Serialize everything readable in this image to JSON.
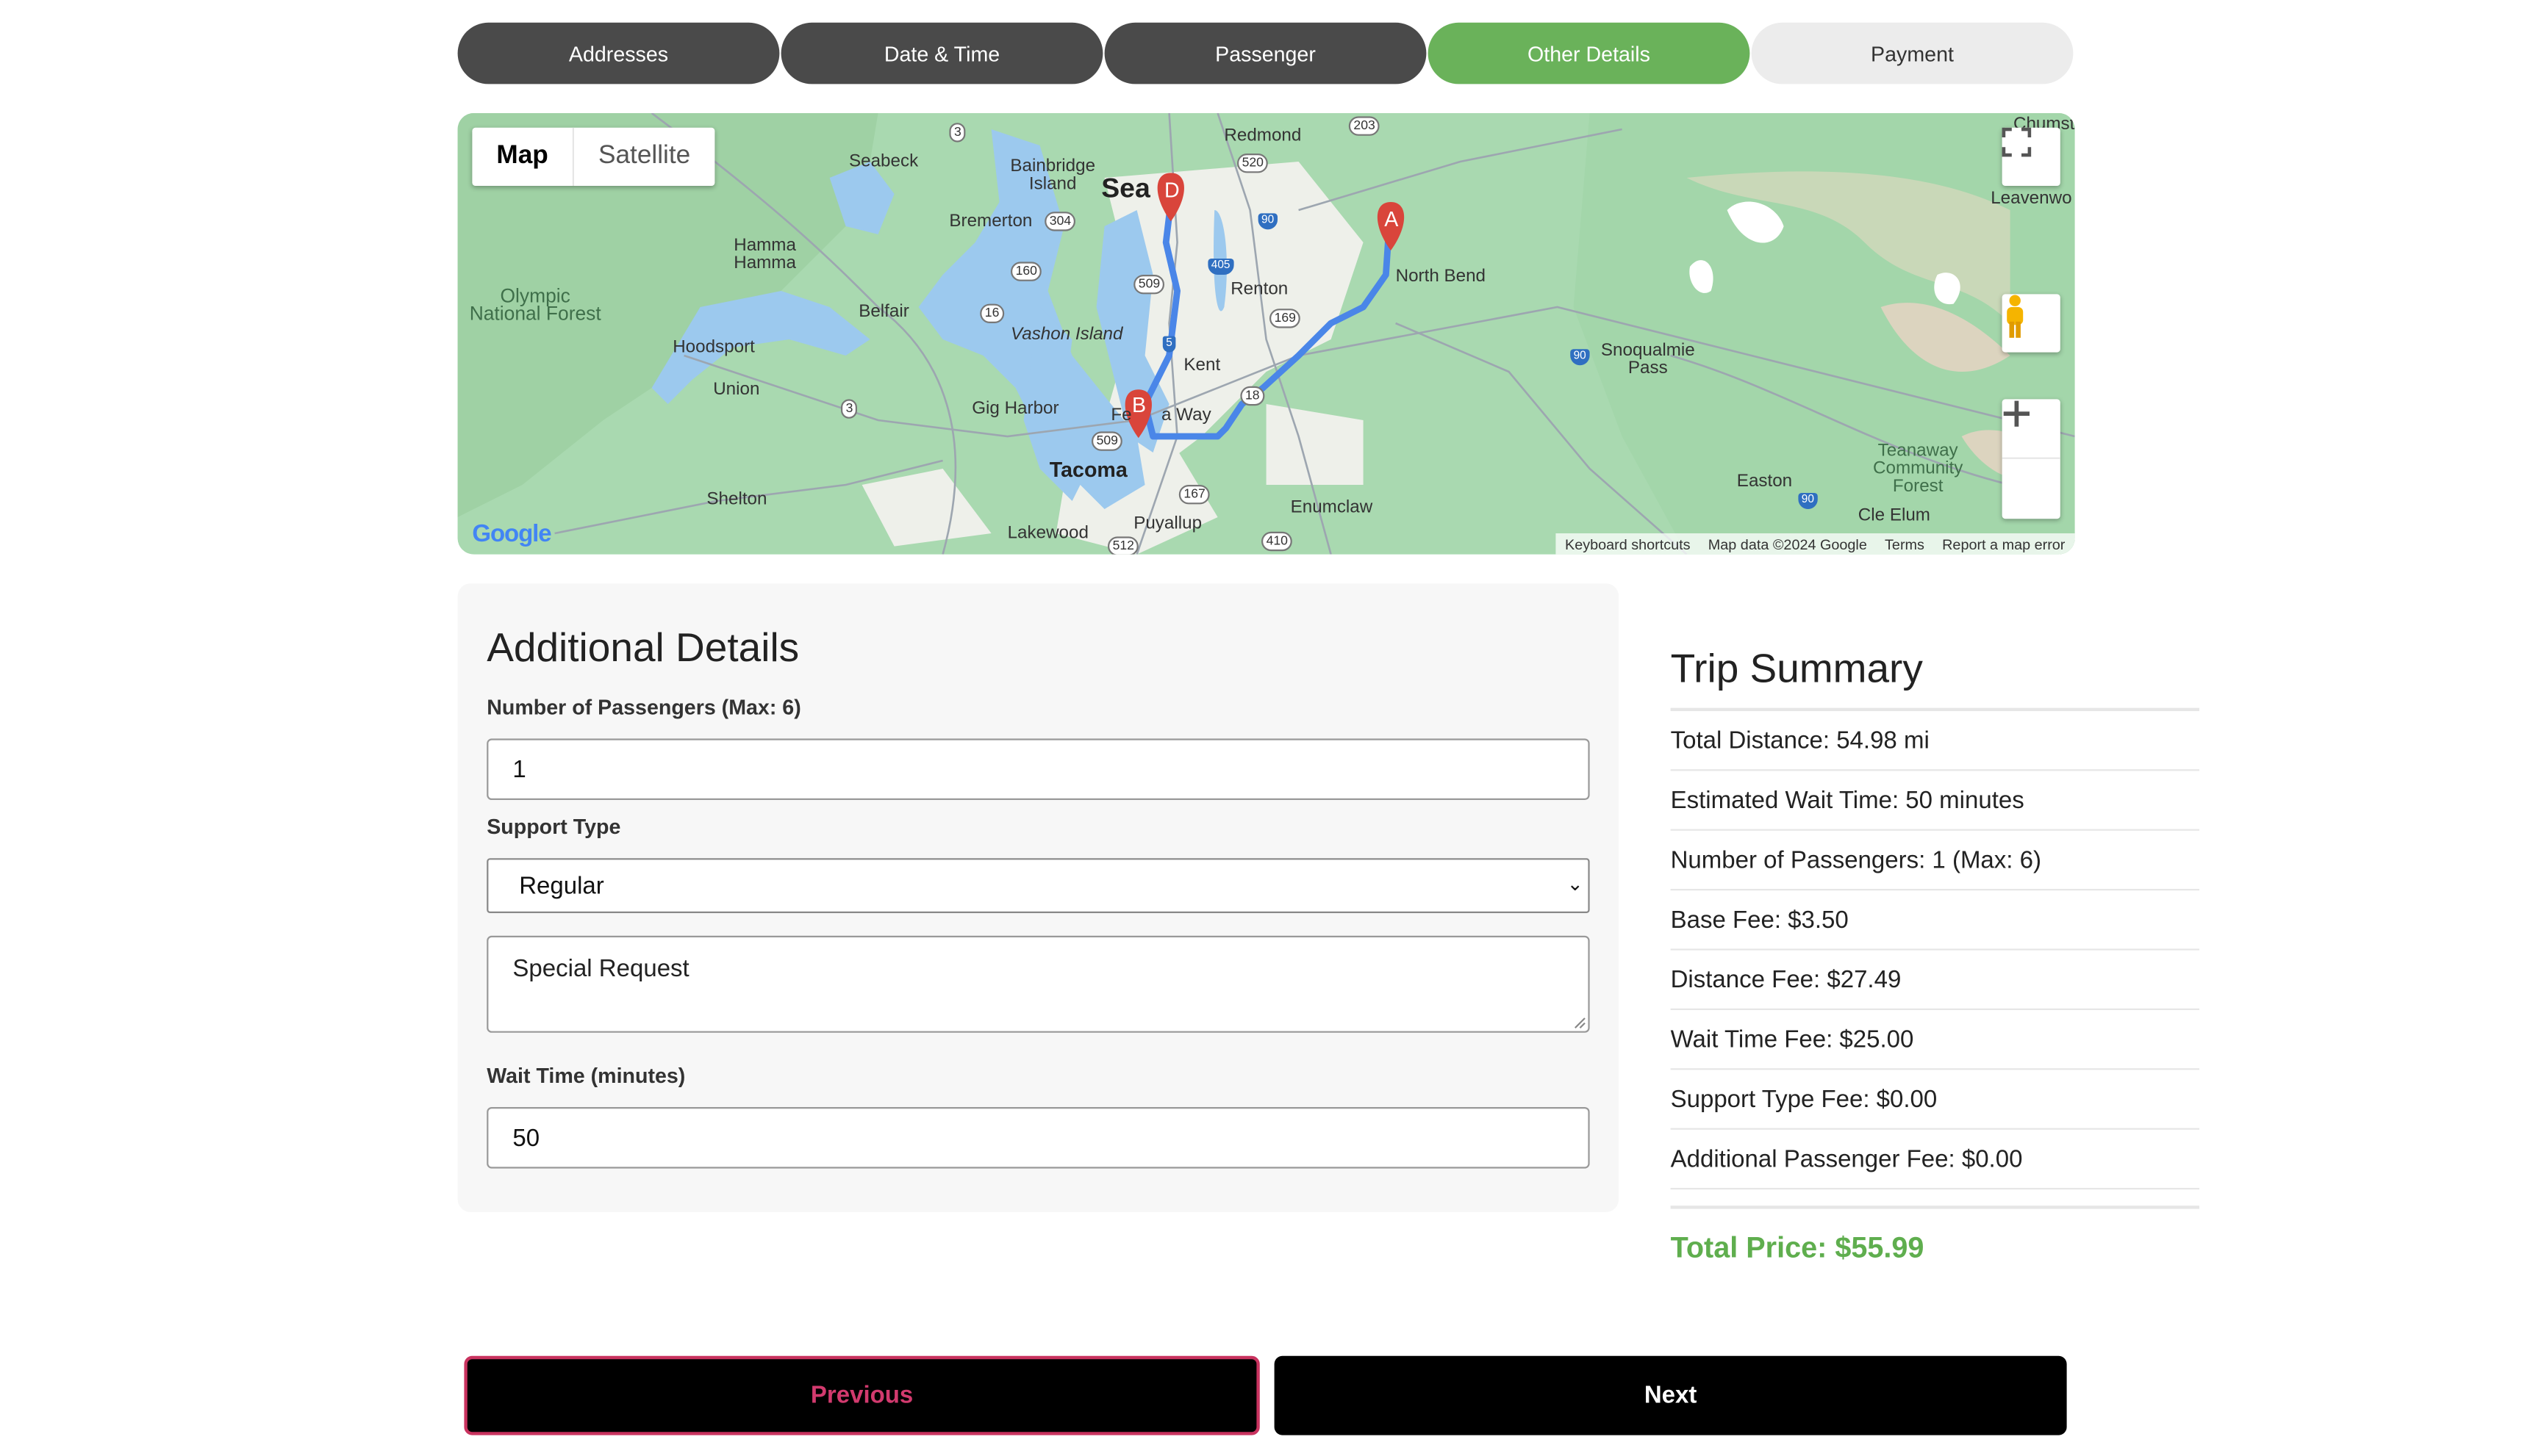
{
  "steps": [
    {
      "label": "Addresses",
      "state": "done"
    },
    {
      "label": "Date & Time",
      "state": "done"
    },
    {
      "label": "Passenger",
      "state": "done"
    },
    {
      "label": "Other Details",
      "state": "active"
    },
    {
      "label": "Payment",
      "state": "todo"
    }
  ],
  "colors": {
    "active": "#6ab25a",
    "done": "#4a4a4a",
    "route": "#4a86e8",
    "marker": "#d9453b",
    "total": "#5fae4e"
  },
  "map": {
    "type_map": "Map",
    "type_satellite": "Satellite",
    "brand": "Google",
    "attribution": {
      "shortcuts": "Keyboard shortcuts",
      "data": "Map data ©2024 Google",
      "terms": "Terms",
      "report": "Report a map error"
    },
    "markers": {
      "a": "A",
      "b": "B",
      "d": "D"
    },
    "places": {
      "seabeck": "Seabeck",
      "bainbridge": "Bainbridge Island",
      "redmond": "Redmond",
      "seattle": "Sea",
      "bremerton": "Bremerton",
      "hamma": "Hamma Hamma",
      "olympic": "Olympic National Forest",
      "belfair": "Belfair",
      "renton": "Renton",
      "northbend": "North Bend",
      "hoodsport": "Hoodsport",
      "vashon": "Vashon Island",
      "snoqualmie": "Snoqualmie Pass",
      "union": "Union",
      "kent": "Kent",
      "gigharbor": "Gig Harbor",
      "federalway": "Fe      a Way",
      "tacoma": "Tacoma",
      "teanaway": "Teanaway Community Forest",
      "easton": "Easton",
      "shelton": "Shelton",
      "enumclaw": "Enumclaw",
      "cleelum": "Cle Elum",
      "puyallup": "Puyallup",
      "lakewood": "Lakewood",
      "leavenworth": "Leavenwo",
      "chumst": "Chumst"
    },
    "shields": {
      "s3a": "3",
      "s203": "203",
      "s520": "520",
      "s304": "304",
      "s90a": "90",
      "s405": "405",
      "s160": "160",
      "s509a": "509",
      "s16": "16",
      "s169": "169",
      "s5": "5",
      "s3b": "3",
      "s18": "18",
      "s509b": "509",
      "s167": "167",
      "s90b": "90",
      "s90c": "90",
      "s410": "410",
      "s512": "512"
    }
  },
  "form": {
    "title": "Additional Details",
    "passengers_label": "Number of Passengers (Max: 6)",
    "passengers_value": "1",
    "support_label": "Support Type",
    "support_value": "Regular",
    "special_request_placeholder": "Special Request",
    "wait_label": "Wait Time (minutes)",
    "wait_value": "50"
  },
  "summary": {
    "title": "Trip Summary",
    "rows": [
      "Total Distance: 54.98 mi",
      "Estimated Wait Time: 50 minutes",
      "Number of Passengers: 1 (Max: 6)",
      "Base Fee: $3.50",
      "Distance Fee: $27.49",
      "Wait Time Fee: $25.00",
      "Support Type Fee: $0.00",
      "Additional Passenger Fee: $0.00"
    ],
    "total": "Total Price: $55.99"
  },
  "nav": {
    "previous": "Previous",
    "next": "Next"
  }
}
